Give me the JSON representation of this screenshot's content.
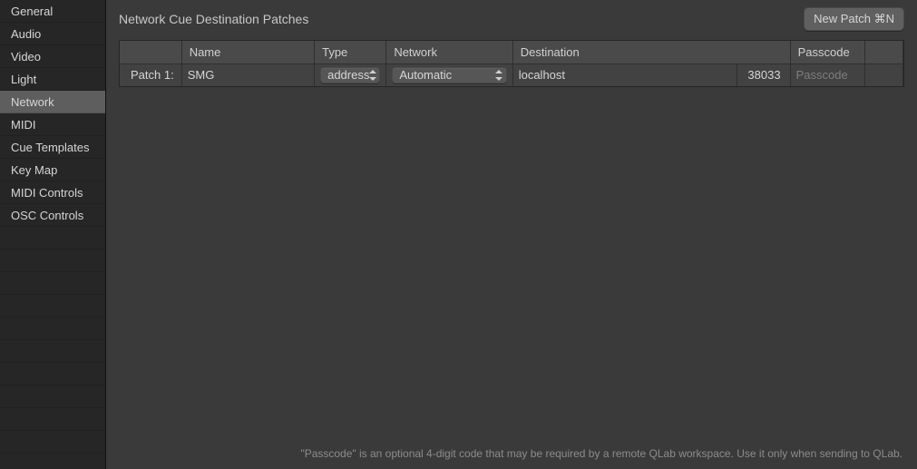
{
  "sidebar": {
    "items": [
      {
        "label": "General"
      },
      {
        "label": "Audio"
      },
      {
        "label": "Video"
      },
      {
        "label": "Light"
      },
      {
        "label": "Network",
        "selected": true
      },
      {
        "label": "MIDI"
      },
      {
        "label": "Cue Templates"
      },
      {
        "label": "Key Map"
      },
      {
        "label": "MIDI Controls"
      },
      {
        "label": "OSC Controls"
      }
    ]
  },
  "header": {
    "title": "Network Cue Destination Patches",
    "new_patch_label": "New Patch  ⌘N"
  },
  "table": {
    "columns": {
      "name": "Name",
      "type": "Type",
      "network": "Network",
      "destination": "Destination",
      "passcode": "Passcode"
    },
    "rows": [
      {
        "patch_label": "Patch 1:",
        "name": "SMG",
        "type": "address",
        "network": "Automatic",
        "destination": "localhost",
        "port": "38033",
        "passcode_placeholder": "Passcode"
      }
    ]
  },
  "footer": {
    "note": "\"Passcode\" is an optional 4-digit code that may be required by a remote QLab workspace. Use it only when sending to QLab."
  }
}
